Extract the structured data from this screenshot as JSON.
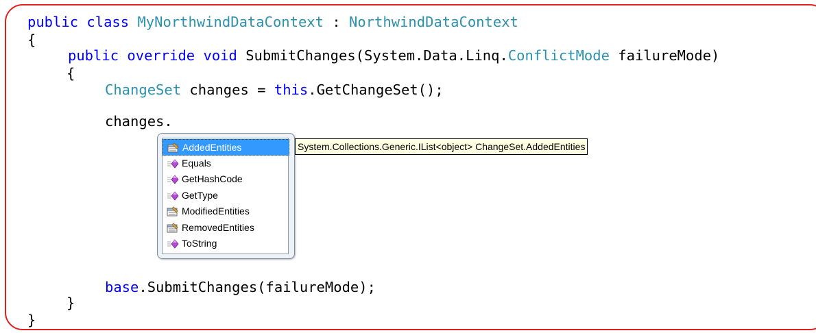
{
  "code": {
    "l1": {
      "kw1": "public",
      "kw2": "class",
      "cls": "MyNorthwindDataContext",
      "sep": " : ",
      "base": "NorthwindDataContext"
    },
    "l2": "{",
    "l3": {
      "kw1": "public",
      "kw2": "override",
      "kw3": "void",
      "pre": "SubmitChanges(System.Data.Linq.",
      "type": "ConflictMode",
      "post": " failureMode)"
    },
    "l4": "{",
    "l5": {
      "type": "ChangeSet",
      "mid": " changes = ",
      "kw": "this",
      "post": ".GetChangeSet();"
    },
    "l6": "changes.",
    "l7": {
      "kw": "base",
      "post": ".SubmitChanges(failureMode);"
    },
    "l8": "}",
    "l9": "}"
  },
  "completion": {
    "items": [
      {
        "label": "AddedEntities",
        "icon": "property-icon",
        "selected": true
      },
      {
        "label": "Equals",
        "icon": "method-icon"
      },
      {
        "label": "GetHashCode",
        "icon": "method-icon"
      },
      {
        "label": "GetType",
        "icon": "method-icon"
      },
      {
        "label": "ModifiedEntities",
        "icon": "property-icon"
      },
      {
        "label": "RemovedEntities",
        "icon": "property-icon"
      },
      {
        "label": "ToString",
        "icon": "method-icon"
      }
    ]
  },
  "tooltip": "System.Collections.Generic.IList<object> ChangeSet.AddedEntities",
  "colors": {
    "keyword": "#0000ff",
    "type": "#2b91af",
    "frame": "#e01f1f",
    "selection": "#3399ff",
    "tooltip_bg": "#ffffe1"
  }
}
